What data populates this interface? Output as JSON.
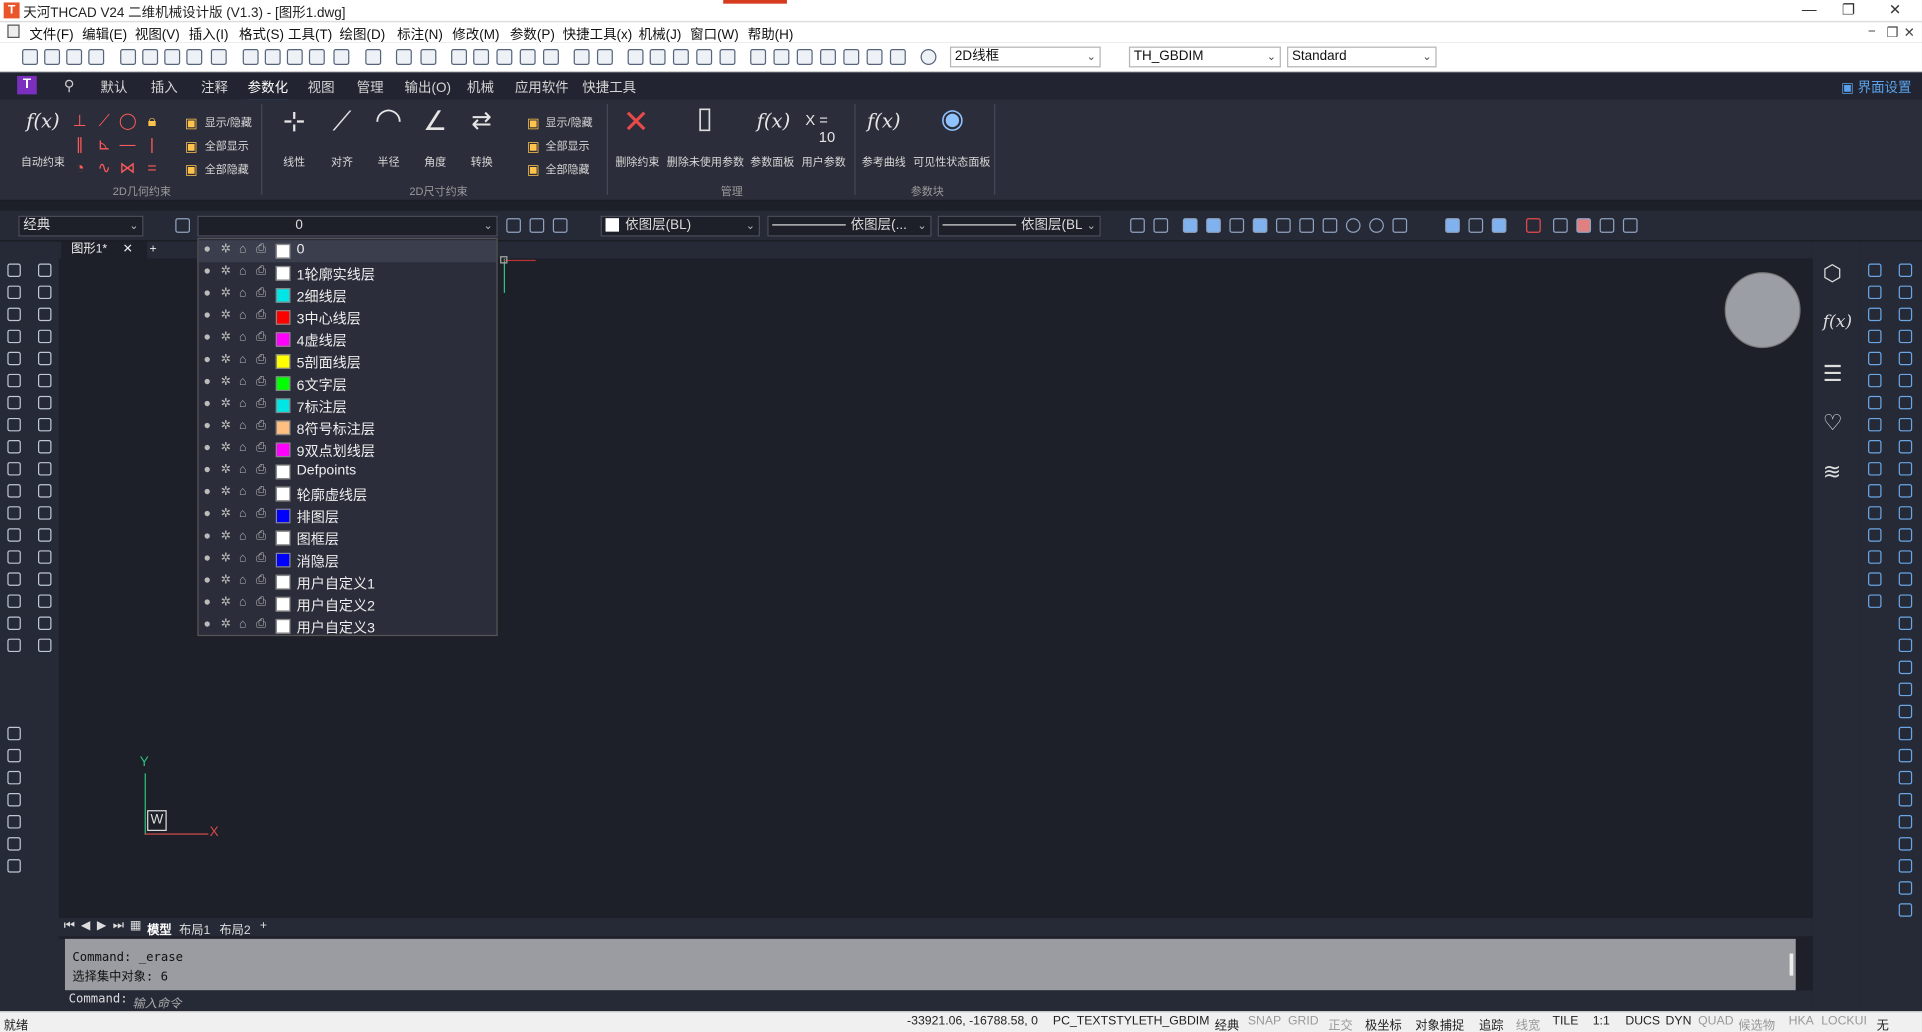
{
  "window": {
    "title": "天河THCAD V24 二维机械设计版 (V1.3) - [图形1.dwg]",
    "controls": [
      "—",
      "❐",
      "✕"
    ]
  },
  "menu": [
    "文件(F)",
    "编辑(E)",
    "视图(V)",
    "插入(I)",
    "格式(S)",
    "工具(T)",
    "绘图(D)",
    "标注(N)",
    "修改(M)",
    "参数(P)",
    "快捷工具(x)",
    "机械(J)",
    "窗口(W)",
    "帮助(H)"
  ],
  "toolbar": {
    "visual_style": "2D线框",
    "dim_style": "TH_GBDIM",
    "text_style": "Standard"
  },
  "ribbon": {
    "tabs": [
      "默认",
      "插入",
      "注释",
      "参数化",
      "视图",
      "管理",
      "输出(O)",
      "机械",
      "应用软件",
      "快捷工具"
    ],
    "active_tab": "参数化",
    "ui_settings": "界面设置",
    "auto_constraint": "自动约束",
    "geo_show_hide": "显示/隐藏",
    "geo_show_all": "全部显示",
    "geo_hide_all": "全部隐藏",
    "group_geo": "2D几何约束",
    "dim_linear": "线性",
    "dim_aligned": "对齐",
    "dim_radius": "半径",
    "dim_angle": "角度",
    "dim_convert": "转换",
    "dim_show_hide": "显示/隐藏",
    "dim_show_all": "全部显示",
    "dim_hide_all": "全部隐藏",
    "group_dim": "2D尺寸约束",
    "delete_constraint": "删除约束",
    "delete_unused": "删除未使用参数",
    "param_panel": "参数面板",
    "user_param": "用户参数",
    "group_manage": "管理",
    "ref_curve": "参考曲线",
    "visibility_panel": "可见性状态面板",
    "group_param_block": "参数块",
    "fx_label": "f(x)",
    "x_eq": "X =",
    "ten": "10"
  },
  "layer_toolbar": {
    "workspace": "经典",
    "current_layer": "0",
    "color": "依图层(BL)",
    "linetype": "依图层(...",
    "lineweight": "依图层(BL"
  },
  "layers": [
    {
      "name": "0",
      "color": "#ffffff"
    },
    {
      "name": "1轮廓实线层",
      "color": "#ffffff"
    },
    {
      "name": "2细线层",
      "color": "#00e5e5"
    },
    {
      "name": "3中心线层",
      "color": "#ff0000"
    },
    {
      "name": "4虚线层",
      "color": "#ff00ff"
    },
    {
      "name": "5剖面线层",
      "color": "#ffff00"
    },
    {
      "name": "6文字层",
      "color": "#00ff00"
    },
    {
      "name": "7标注层",
      "color": "#00e5e5"
    },
    {
      "name": "8符号标注层",
      "color": "#ffbf80"
    },
    {
      "name": "9双点划线层",
      "color": "#ff00ff"
    },
    {
      "name": "Defpoints",
      "color": "#ffffff"
    },
    {
      "name": "轮廓虚线层",
      "color": "#ffffff"
    },
    {
      "name": "排图层",
      "color": "#0000ff"
    },
    {
      "name": "图框层",
      "color": "#ffffff"
    },
    {
      "name": "消隐层",
      "color": "#0000ff"
    },
    {
      "name": "用户自定义1",
      "color": "#ffffff"
    },
    {
      "name": "用户自定义2",
      "color": "#ffffff"
    },
    {
      "name": "用户自定义3",
      "color": "#ffffff"
    }
  ],
  "document": {
    "tab": "图形1*",
    "close": "✕",
    "new": "+"
  },
  "ucs": {
    "x": "X",
    "y": "Y",
    "w": "W"
  },
  "layout_tabs": [
    "模型",
    "布局1",
    "布局2",
    "+"
  ],
  "command": {
    "history": [
      "Command: _erase",
      "选择集中对象:  6"
    ],
    "prompt": "Command:",
    "placeholder": "输入命令"
  },
  "status": {
    "ready": "就绪",
    "coords": "-33921.06, -16788.58, 0",
    "items": [
      "PC_TEXTSTYLE",
      "TH_GBDIM",
      "经典"
    ],
    "toggles": [
      {
        "label": "SNAP",
        "on": false
      },
      {
        "label": "GRID",
        "on": false
      },
      {
        "label": "正交",
        "on": false
      },
      {
        "label": "极坐标",
        "on": true
      },
      {
        "label": "对象捕捉",
        "on": true
      },
      {
        "label": "追踪",
        "on": true
      },
      {
        "label": "线宽",
        "on": false
      },
      {
        "label": "TILE",
        "on": true
      },
      {
        "label": "1:1",
        "on": true
      },
      {
        "label": "DUCS",
        "on": true
      },
      {
        "label": "DYN",
        "on": true
      },
      {
        "label": "QUAD",
        "on": false
      },
      {
        "label": "候选物",
        "on": false
      },
      {
        "label": "HKA",
        "on": false
      },
      {
        "label": "LOCKUI",
        "on": false
      },
      {
        "label": "无",
        "on": true
      }
    ]
  }
}
